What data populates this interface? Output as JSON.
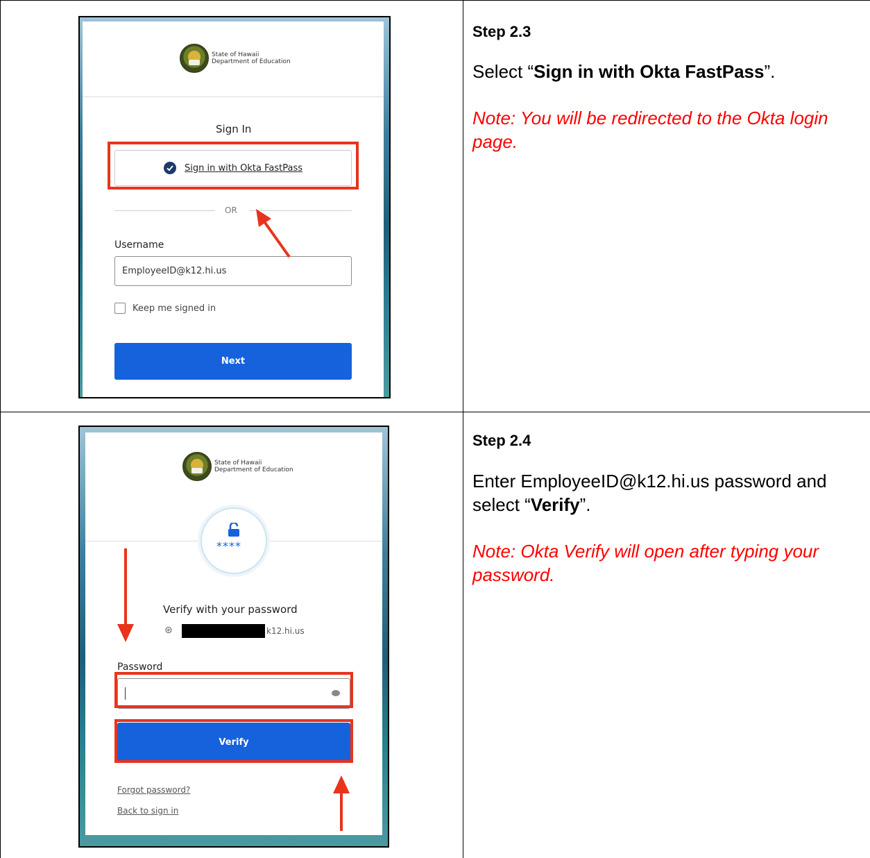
{
  "rows": [
    {
      "screenshot": {
        "logo": {
          "line1": "State of Hawaii",
          "line2": "Department of Education"
        },
        "heading": "Sign In",
        "fastpass_label": "Sign in with Okta FastPass",
        "or_label": "OR",
        "username_label": "Username",
        "username_value": "EmployeeID@k12.hi.us",
        "keep_signed_in_label": "Keep me signed in",
        "next_label": "Next"
      },
      "instructions": {
        "title": "Step 2.3",
        "body_prefix": "Select “",
        "body_bold": "Sign in with Okta FastPass",
        "body_suffix": "”.",
        "note": "Note: You will be redirected to the Okta login page."
      }
    },
    {
      "screenshot": {
        "logo": {
          "line1": "State of Hawaii",
          "line2": "Department of Education"
        },
        "password_icon_text": "****",
        "heading": "Verify with your password",
        "user_suffix": "k12.hi.us",
        "password_label": "Password",
        "verify_label": "Verify",
        "forgot_link": "Forgot password?",
        "back_link": "Back to sign in"
      },
      "instructions": {
        "title": "Step 2.4",
        "body_prefix": "Enter EmployeeID@k12.hi.us password and select “",
        "body_bold": "Verify",
        "body_suffix": "”.",
        "note": "Note: Okta Verify will open after typing your password."
      }
    }
  ],
  "colors": {
    "highlight": "#e8341c",
    "primary": "#1662dd",
    "note": "#ff0000"
  }
}
